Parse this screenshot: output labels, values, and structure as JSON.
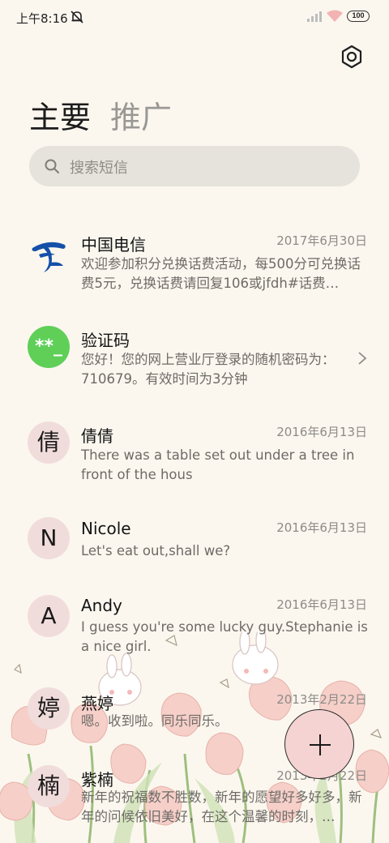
{
  "status_bar": {
    "time": "上午8:16",
    "battery": "100"
  },
  "tabs": [
    {
      "label": "主要",
      "active": true
    },
    {
      "label": "推广",
      "active": false
    }
  ],
  "search": {
    "placeholder": "搜索短信"
  },
  "conversations": [
    {
      "name": "中国电信",
      "date": "2017年6月30日",
      "preview": "欢迎参加积分兑换话费活动，每500分可兑换话费5元，兑换话费请回复106或jfdh#话费…",
      "avatar": "china-telecom-logo"
    },
    {
      "name": "验证码",
      "date": "",
      "preview": "您好！您的网上营业厅登录的随机密码为：710679。有效时间为3分钟",
      "avatar_text": "**_",
      "avatar_color": "#5fcf58"
    },
    {
      "name": "倩倩",
      "date": "2016年6月13日",
      "preview": "There was a table set out under a tree in front of the hous",
      "avatar_text": "倩"
    },
    {
      "name": "Nicole",
      "date": "2016年6月13日",
      "preview": "Let's eat out,shall we?",
      "avatar_text": "N"
    },
    {
      "name": "Andy",
      "date": "2016年6月13日",
      "preview": "I guess you're some lucky guy.Stephanie is a nice girl.",
      "avatar_text": "A"
    },
    {
      "name": "燕婷",
      "date": "2013年2月22日",
      "preview": "嗯。收到啦。同乐同乐。",
      "avatar_text": "婷"
    },
    {
      "name": "紫楠",
      "date": "2013年2月22日",
      "preview": "新年的祝福数不胜数，新年的愿望好多好多，新年的问候依旧美好，在这个温馨的时刻，…",
      "avatar_text": "楠"
    }
  ],
  "colors": {
    "background": "#fbf7ef",
    "avatar_bg": "#f1dcdc",
    "fab_bg": "#f5d3d3"
  }
}
